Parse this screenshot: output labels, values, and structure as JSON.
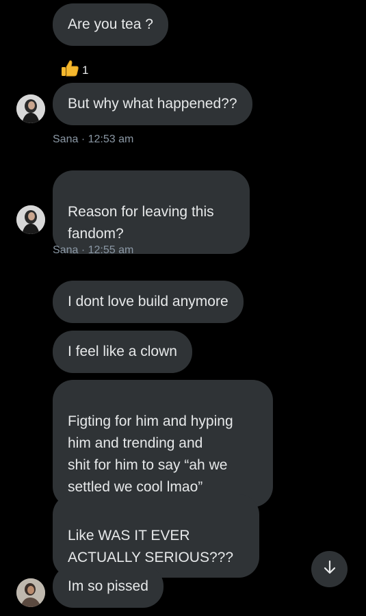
{
  "messages": {
    "m1": "Are you tea ?",
    "m2": "But why what happened??",
    "m3": "Reason for leaving this\nfandom?",
    "m4": "I dont love build anymore",
    "m5": "I feel like a clown",
    "m6": "Figting for him and hyping\nhim and trending and\nshit for him to say “ah we\nsettled we cool lmao”",
    "m7": "Like WAS IT EVER\nACTUALLY SERIOUS???",
    "m8": "Im so pissed"
  },
  "reaction": {
    "icon": "thumbs-up-icon",
    "count": "1"
  },
  "meta": {
    "first": "Sana · 12:53 am",
    "second": "Sana · 12:55 am"
  },
  "colors": {
    "background": "#000000",
    "bubble": "#2f3336",
    "text": "#e7e9ea",
    "meta_text": "#8b98a5"
  },
  "icons": {
    "scroll_button": "arrow-down-icon",
    "avatar": "avatar"
  }
}
